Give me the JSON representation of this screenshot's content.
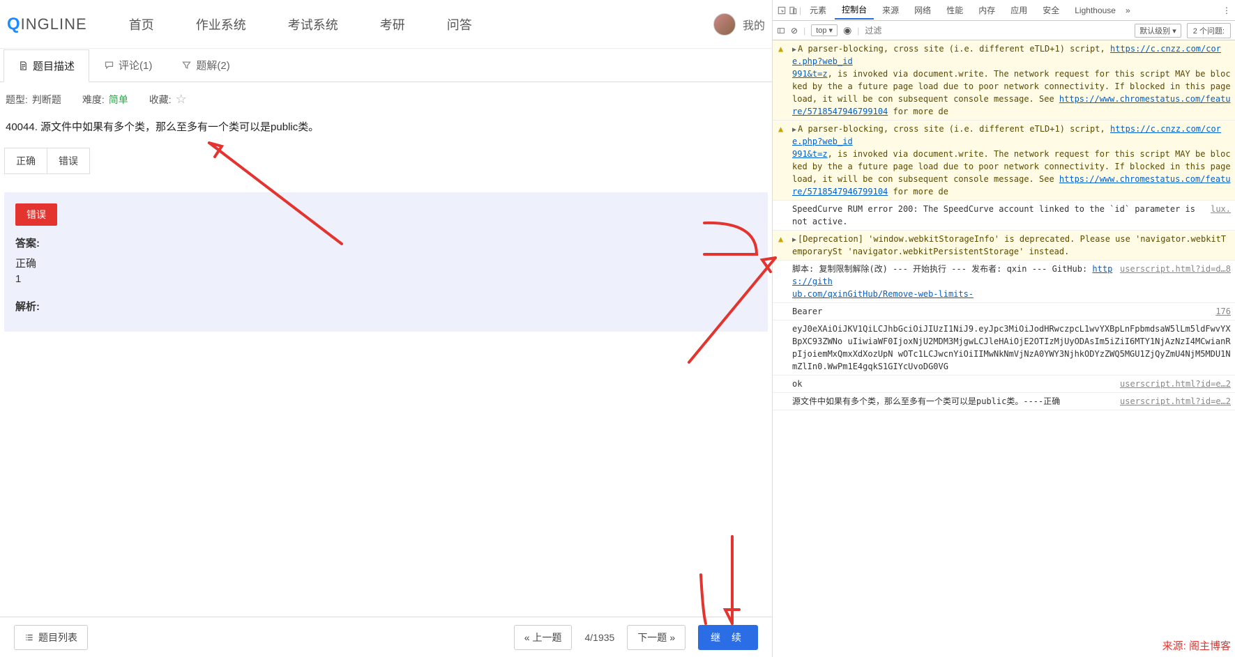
{
  "logo": {
    "q": "Q",
    "rest": "INGLINE"
  },
  "nav": {
    "home": "首页",
    "hw": "作业系统",
    "exam": "考试系统",
    "kaoyan": "考研",
    "qa": "问答",
    "mine": "我的"
  },
  "tabs": {
    "desc": "题目描述",
    "comment": "评论(1)",
    "solution": "题解(2)"
  },
  "meta": {
    "type_label": "题型:",
    "type_val": "判断题",
    "diff_label": "难度:",
    "diff_val": "简单",
    "fav_label": "收藏:"
  },
  "question": "40044. 源文件中如果有多个类，那么至多有一个类可以是public类。",
  "choices": {
    "t": "正确",
    "f": "错误"
  },
  "badge": "错误",
  "answer": {
    "label": "答案:",
    "val": "正确",
    "num": "1",
    "explain_label": "解析:"
  },
  "footer": {
    "list": "题目列表",
    "prev": "上一题",
    "page": "4/1935",
    "next": "下一题",
    "continue": "继 续"
  },
  "devtools": {
    "tabs": {
      "elements": "元素",
      "console": "控制台",
      "sources": "来源",
      "network": "网络",
      "perf": "性能",
      "memory": "内存",
      "app": "应用",
      "security": "安全",
      "lighthouse": "Lighthouse"
    },
    "sub": {
      "top": "top",
      "filter_ph": "过滤",
      "level": "默认级别",
      "issues": "2 个问题:"
    },
    "msgs": [
      {
        "type": "warn",
        "expand": true,
        "text_pre": "A parser-blocking, cross site (i.e. different eTLD+1) script, ",
        "link1": "https://c.cnzz.com/core.php?web_id",
        "text_mid": ", is invoked via document.write. The network request for this script MAY be blocked by the a future page load due to poor network connectivity. If blocked in this page load, it will be con subsequent console message. See ",
        "link2": "https://www.chromestatus.com/feature/5718547946799104",
        "text_post": " for more de",
        "line2_prefix": "991&t=z"
      },
      {
        "type": "warn",
        "expand": true,
        "text_pre": "A parser-blocking, cross site (i.e. different eTLD+1) script, ",
        "link1": "https://c.cnzz.com/core.php?web_id",
        "text_mid": ", is invoked via document.write. The network request for this script MAY be blocked by the a future page load due to poor network connectivity. If blocked in this page load, it will be con subsequent console message. See ",
        "link2": "https://www.chromestatus.com/feature/5718547946799104",
        "text_post": " for more de",
        "line2_prefix": "991&t=z"
      },
      {
        "type": "info",
        "text": "SpeedCurve RUM error 200: The SpeedCurve account linked to the `id` parameter is not active.",
        "src": "lux."
      },
      {
        "type": "warn",
        "expand": true,
        "text": "[Deprecation] 'window.webkitStorageInfo' is deprecated. Please use 'navigator.webkitTemporarySt 'navigator.webkitPersistentStorage' instead."
      },
      {
        "type": "info",
        "text_pre": "脚本: 复制限制解除(改) --- 开始执行 --- 发布者: qxin --- GitHub: ",
        "link1": "https://gith",
        "link2_text": "ub.com/qxinGitHub/Remove-web-limits-",
        "src": "userscript.html?id=d…8"
      },
      {
        "type": "info",
        "text": "Bearer",
        "src": "176"
      },
      {
        "type": "info",
        "text": "eyJ0eXAiOiJKV1QiLCJhbGciOiJIUzI1NiJ9.eyJpc3MiOiJodHRwczpcL1wvYXBpLnFpbmdsaW5lLm5ldFwvYXBpXC93ZWNo uIiwiaWF0IjoxNjU2MDM3MjgwLCJleHAiOjE2OTIzMjUyODAsIm5iZiI6MTY1NjAzNzI4MCwianRpIjoiemMxQmxXdXozUpN wOTc1LCJwcnYiOiIIMwNkNmVjNzA0YWY3NjhkODYzZWQ5MGU1ZjQyZmU4NjM5MDU1NmZlIn0.WwPm1E4gqkS1GIYcUvoDG0VG"
      },
      {
        "type": "info",
        "text": "ok",
        "src": "userscript.html?id=e…2"
      },
      {
        "type": "info",
        "text": "源文件中如果有多个类，那么至多有一个类可以是public类。----正确",
        "src": "userscript.html?id=e…2"
      }
    ]
  },
  "watermark": "来源: 阁主博客"
}
